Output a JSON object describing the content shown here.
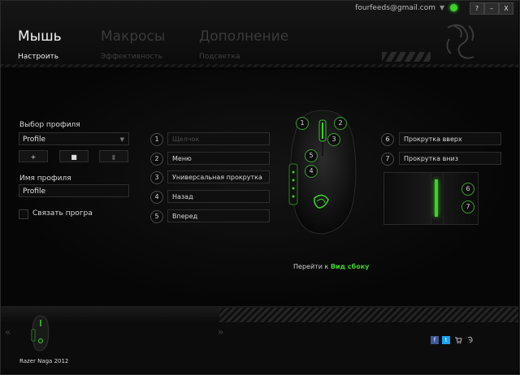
{
  "account": {
    "email": "fourfeeds@gmail.com"
  },
  "window_buttons": [
    "?",
    "–",
    "X"
  ],
  "tabs": [
    {
      "label": "Мышь",
      "active": true
    },
    {
      "label": "Макросы",
      "active": false
    },
    {
      "label": "Дополнение",
      "active": false
    }
  ],
  "subtabs": [
    {
      "label": "Настроить",
      "active": true
    },
    {
      "label": "Эффективность",
      "active": false
    },
    {
      "label": "Подсветка",
      "active": false
    }
  ],
  "profile": {
    "select_label": "Выбор профиля",
    "selected": "Profile",
    "buttons": [
      "+",
      "■",
      "▮"
    ],
    "name_label": "Имя профиля",
    "name_value": "Profile",
    "link_label": "Связать програ"
  },
  "buttons_left": [
    {
      "num": "1",
      "label": "Щелчок",
      "dim": true
    },
    {
      "num": "2",
      "label": "Меню"
    },
    {
      "num": "3",
      "label": "Универсальная прокрутка"
    },
    {
      "num": "4",
      "label": "Назад"
    },
    {
      "num": "5",
      "label": "Вперед"
    }
  ],
  "buttons_right": [
    {
      "num": "6",
      "label": "Прокрутка вверх"
    },
    {
      "num": "7",
      "label": "Прокрутка вниз"
    }
  ],
  "mouse_markers": [
    "1",
    "2",
    "3",
    "5",
    "4"
  ],
  "side_markers": [
    "6",
    "7"
  ],
  "goto": {
    "prefix": "Перейти к",
    "link": "Вид сбоку"
  },
  "device": {
    "name": "Razer Naga 2012"
  },
  "nav_arrows": [
    "«",
    "»"
  ],
  "social": [
    "f",
    "t",
    "cart",
    "razer"
  ],
  "colors": {
    "accent": "#3fd12a",
    "bg": "#050505"
  }
}
